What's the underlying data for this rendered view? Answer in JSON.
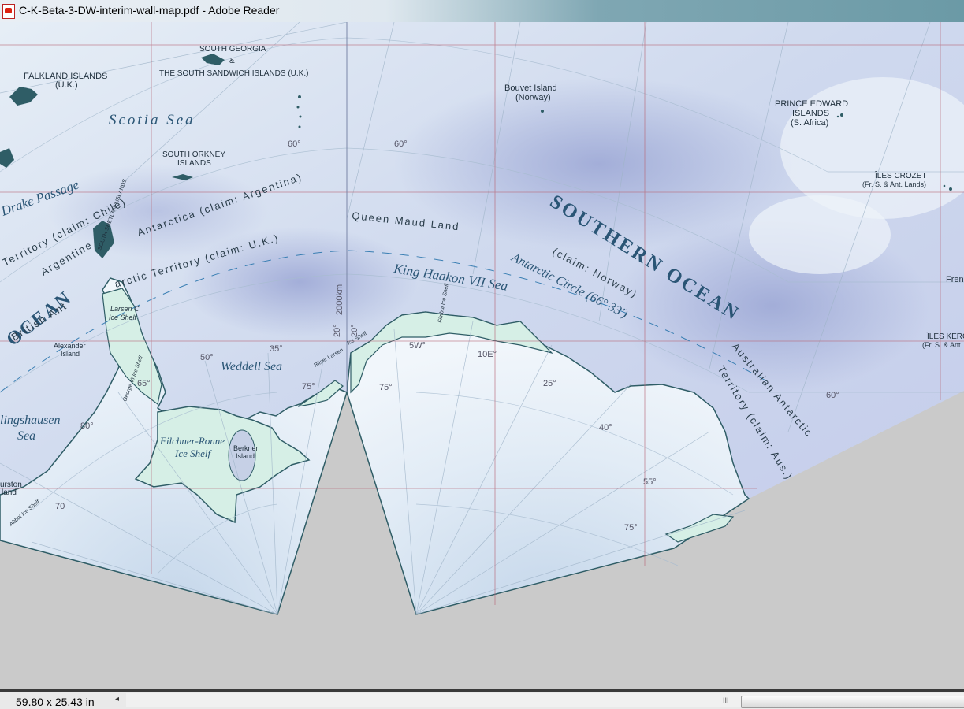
{
  "window": {
    "title": "C-K-Beta-3-DW-interim-wall-map.pdf - Adobe Reader"
  },
  "status": {
    "page_size": "59.80 x 25.43 in",
    "scroll_left_icon": "◂",
    "grip_icon": "III"
  },
  "map": {
    "places": {
      "falkland": "FALKLAND ISLANDS",
      "falkland_claim": "(U.K.)",
      "south_georgia": "SOUTH GEORGIA",
      "amp": "&",
      "south_sandwich": "THE SOUTH SANDWICH ISLANDS (U.K.)",
      "bouvet": "Bouvet Island",
      "bouvet_claim": "(Norway)",
      "prince_edward_1": "PRINCE EDWARD",
      "prince_edward_2": "ISLANDS",
      "prince_edward_claim": "(S. Africa)",
      "crozet": "ÎLES CROZET",
      "crozet_claim": "(Fr. S. & Ant. Lands)",
      "kerguelen": "ÎLES KERG",
      "kerguelen_claim": "(Fr. S. & Ant",
      "south_orkney_1": "SOUTH ORKNEY",
      "south_orkney_2": "ISLANDS",
      "south_shetland": "SOUTH SHETLAND ISLANDS",
      "alexander_1": "Alexander",
      "alexander_2": "Island",
      "berkner_1": "Berkner",
      "berkner_2": "Island",
      "thurston_1": "urston",
      "thurston_2": "land",
      "fren": "Fren"
    },
    "seas": {
      "scotia": "Scotia Sea",
      "drake": "Drake Passage",
      "weddell": "Weddell Sea",
      "king_haakon": "King Haakon VII Sea",
      "bellingshausen_1": "lingshausen",
      "bellingshausen_2": "Sea",
      "southern_ocean": "SOUTHERN OCEAN",
      "ocean_left": "OCEAN",
      "antarctic_circle": "Antarctic Circle (66° 33′)"
    },
    "ice_shelves": {
      "larsen_1": "Larsen C",
      "larsen_2": "Ice Shelf",
      "filchner_1": "Filchner-Ronne",
      "filchner_2": "Ice Shelf",
      "riiser": "Riiser Larsen",
      "riiser_2": "Ice Shelf",
      "fimbul": "Fimbul Ice Shelf",
      "abbot": "Abbot Ice Shelf",
      "george": "George VI Ice Shelf"
    },
    "claims": {
      "chile": "Territory (claim: Chile)",
      "argentina": "Antarctica (claim: Argentina)",
      "argentine": "Argentine",
      "uk_1": "British Ant",
      "uk_2": "arctic Territory (claim: U.K.)",
      "norway_1": "Queen Maud Land",
      "norway_2": "(claim: Norway)",
      "australia_1": "Australian Antarctic",
      "australia_2": "Territory (claim: Aus.)"
    },
    "scale_label": "2000km",
    "grid_labels": {
      "lat60_a": "60°",
      "lat60_b": "60°",
      "lat50": "50°",
      "lat35": "35°",
      "lat20_a": "20°",
      "lat20_b": "20°",
      "lat65": "65°",
      "lat75_a": "75°",
      "lat75_b": "75°",
      "lat75_c": "75°",
      "lat80": "80°",
      "lon5w": "5W°",
      "lon10e": "10E°",
      "lon25": "25°",
      "lon40": "40°",
      "lon55": "55°",
      "lon60": "60°",
      "lat70": "70"
    },
    "colors": {
      "ocean_light": "#dde8f2",
      "ocean_deep": "#a9b6dc",
      "ice_shelf": "#d6efe6",
      "land": "#e7f0f8",
      "coast": "#2f5d66",
      "grid_red": "#b86a7a",
      "gray_bg": "#cacaca"
    }
  }
}
